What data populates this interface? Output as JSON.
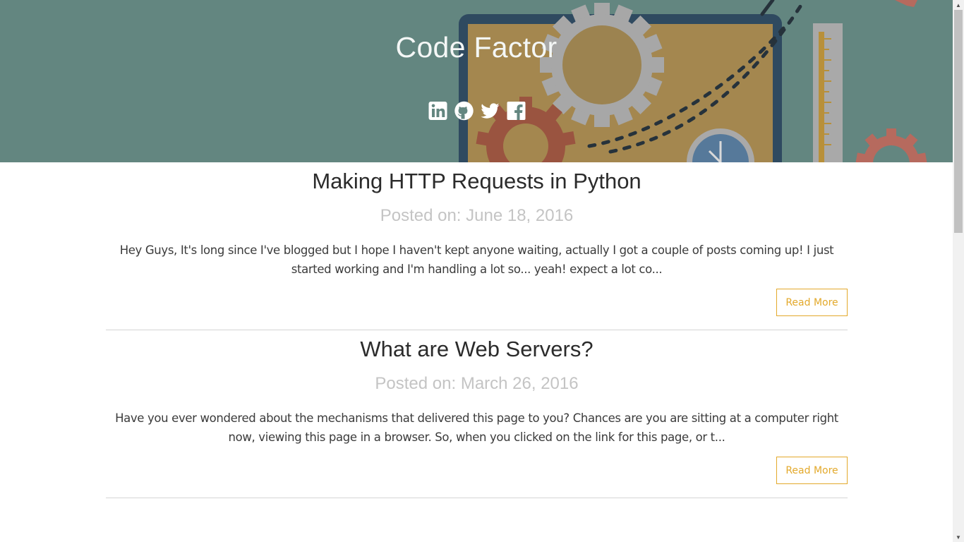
{
  "header": {
    "site_title": "Code Factor",
    "background_color": "#638680",
    "social_icons": [
      "linkedin-icon",
      "github-icon",
      "twitter-icon",
      "facebook-icon"
    ]
  },
  "posts": [
    {
      "title": "Making HTTP Requests in Python",
      "date": "Posted on: June 18, 2016",
      "excerpt": "Hey Guys, It's long since I've blogged but I hope I haven't kept anyone waiting, actually I got a couple of posts coming up! I just started working and I'm handling a lot so... yeah! expect a lot co...",
      "read_more": "Read More"
    },
    {
      "title": "What are Web Servers?",
      "date": "Posted on: March 26, 2016",
      "excerpt": "Have you ever wondered about the mechanisms that delivered this page to you? Chances are you are sitting at a computer right now, viewing this page in a browser. So, when you clicked on the link for this page, or t...",
      "read_more": "Read More"
    }
  ],
  "colors": {
    "accent": "#e3a92b",
    "title_text": "#2b2b2b",
    "date_text": "#c4c4c4"
  }
}
